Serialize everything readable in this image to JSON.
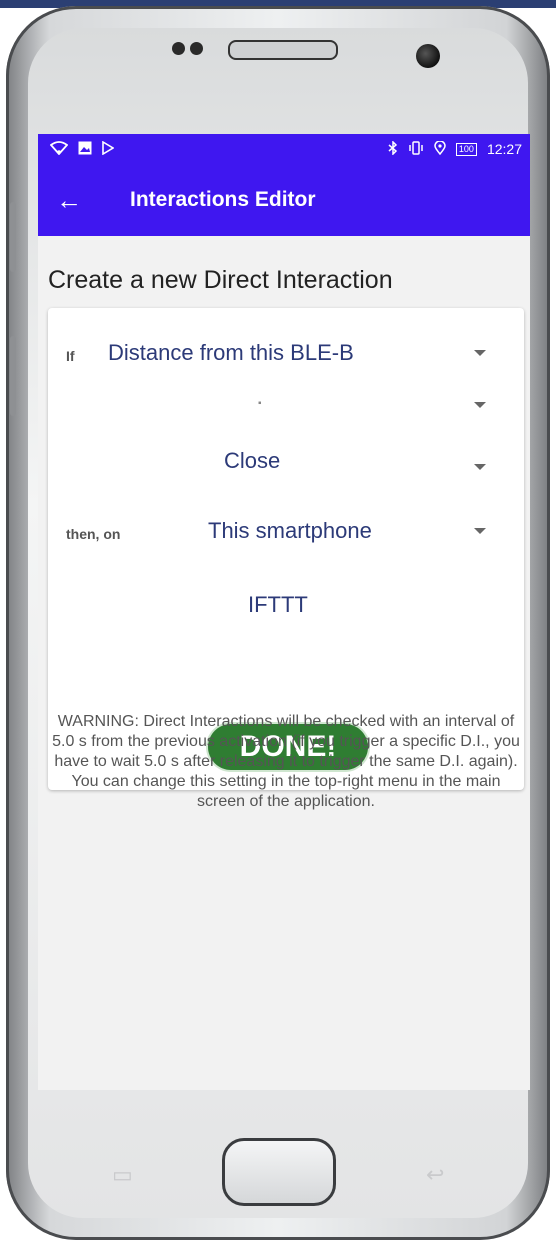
{
  "status_bar": {
    "battery": "100",
    "time": "12:27"
  },
  "app_bar": {
    "title": "Interactions Editor"
  },
  "heading": "Create a new Direct Interaction",
  "form": {
    "if_label": "If",
    "trigger": "Distance from this BLE-B",
    "device": "",
    "condition": "Close",
    "then_label": "then, on",
    "target": "This smartphone",
    "action": "IFTTT"
  },
  "done_label": "DONE!",
  "warning": "WARNING: Direct Interactions will be checked with an interval of 5.0 s from the previous activation (if you trigger a specific D.I., you have to wait 5.0 s after releasing it to trigger the same D.I. again). You can change this setting in the top-right menu in the main screen of the application.",
  "colors": {
    "primary": "#3f17f0",
    "done": "#2f7d32",
    "value_text": "#2c3a78"
  }
}
